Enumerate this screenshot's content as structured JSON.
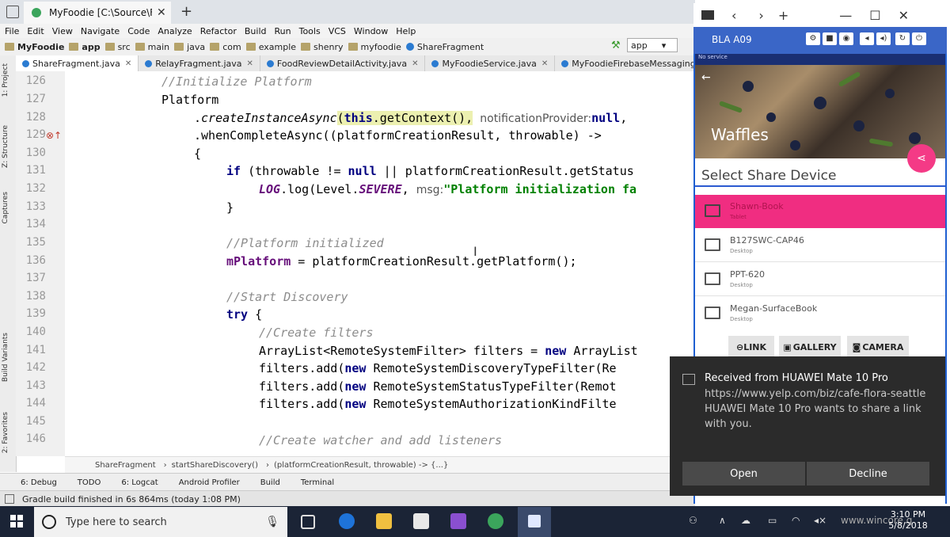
{
  "browser": {
    "tab_title": "MyFoodie [C:\\Source\\F",
    "tab_close": "✕",
    "new_tab": "+"
  },
  "menu": [
    "File",
    "Edit",
    "View",
    "Navigate",
    "Code",
    "Analyze",
    "Refactor",
    "Build",
    "Run",
    "Tools",
    "VCS",
    "Window",
    "Help"
  ],
  "breadcrumb": [
    "MyFoodie",
    "app",
    "src",
    "main",
    "java",
    "com",
    "example",
    "shenry",
    "myfoodie",
    "ShareFragment"
  ],
  "run_config": "app",
  "file_tabs": [
    "ShareFragment.java",
    "RelayFragment.java",
    "FoodReviewDetailActivity.java",
    "MyFoodieService.java",
    "MyFoodieFirebaseMessagingService.java"
  ],
  "left_tools": [
    "1: Project",
    "Z: Structure",
    "Captures",
    "Build Variants",
    "2: Favorites"
  ],
  "code": {
    "line_numbers": [
      "126",
      "127",
      "128",
      "129",
      "130",
      "131",
      "132",
      "133",
      "134",
      "135",
      "136",
      "137",
      "138",
      "139",
      "140",
      "141",
      "142",
      "143",
      "144",
      "145",
      "146"
    ],
    "l126": "//Initialize Platform",
    "l127": "Platform",
    "l128a": ".",
    "l128b": "createInstanceAsync",
    "l128c": "(",
    "l128d": "this",
    "l128e": ".getContext(),",
    "l128hint": "notificationProvider:",
    "l128f": "null",
    "l128g": ",",
    "l129": ".whenCompleteAsync((platformCreationResult, throwable) ->",
    "l130": "{",
    "l131a": "if",
    "l131b": " (throwable != ",
    "l131c": "null",
    "l131d": " || platformCreationResult.getStatus",
    "l132a": "LOG",
    "l132b": ".log(Level.",
    "l132c": "SEVERE",
    "l132d": ",",
    "l132hint": "msg:",
    "l132e": "\"Platform initialization fa",
    "l133": "}",
    "l135": "//Platform initialized",
    "l136a": "mPlatform",
    "l136b": " = platformCreationResult.getPlatform();",
    "l138": "//Start Discovery",
    "l139a": "try",
    "l139b": " {",
    "l140": "//Create filters",
    "l141a": "ArrayList<RemoteSystemFilter> filters = ",
    "l141b": "new",
    "l141c": " ArrayList",
    "l142a": "filters.add(",
    "l142b": "new",
    "l142c": " RemoteSystemDiscoveryTypeFilter(Re",
    "l143c": " RemoteSystemStatusTypeFilter(Remot",
    "l144c": " RemoteSystemAuthorizationKindFilte",
    "l146": "//Create watcher and add listeners"
  },
  "code_crumb": [
    "ShareFragment",
    "startShareDiscovery()",
    "(platformCreationResult, throwable) -> {...}"
  ],
  "tool_windows": [
    "6: Debug",
    "TODO",
    "6: Logcat",
    "Android Profiler",
    "Build",
    "Terminal"
  ],
  "status": "Gradle build finished in 6s 864ms (today 1:08 PM)",
  "emulator": {
    "window_controls": [
      "‹",
      "›",
      "+",
      "—",
      "☐",
      "✕"
    ],
    "device_name": "BLA A09",
    "phone_status": "No service",
    "hero_title": "Waffles",
    "share_title": "Select Share Device",
    "devices": [
      {
        "name": "Shawn-Book",
        "type": "Tablet"
      },
      {
        "name": "B127SWC-CAP46",
        "type": "Desktop"
      },
      {
        "name": "PPT-620",
        "type": "Desktop"
      },
      {
        "name": "Megan-SurfaceBook",
        "type": "Desktop"
      }
    ],
    "buttons": [
      "LINK",
      "GALLERY",
      "CAMERA"
    ]
  },
  "toast": {
    "title": "Received from HUAWEI Mate 10 Pro",
    "body": "https://www.yelp.com/biz/cafe-flora-seattle HUAWEI Mate 10 Pro wants to share a link with you.",
    "open": "Open",
    "decline": "Decline"
  },
  "taskbar": {
    "search_placeholder": "Type here to search",
    "time": "3:10 PM",
    "date": "5/8/2018",
    "watermark": "www.wincore.g"
  },
  "colors": {
    "accent": "#f02d81",
    "emulator": "#3a66c7",
    "taskbar": "#1b2436"
  }
}
